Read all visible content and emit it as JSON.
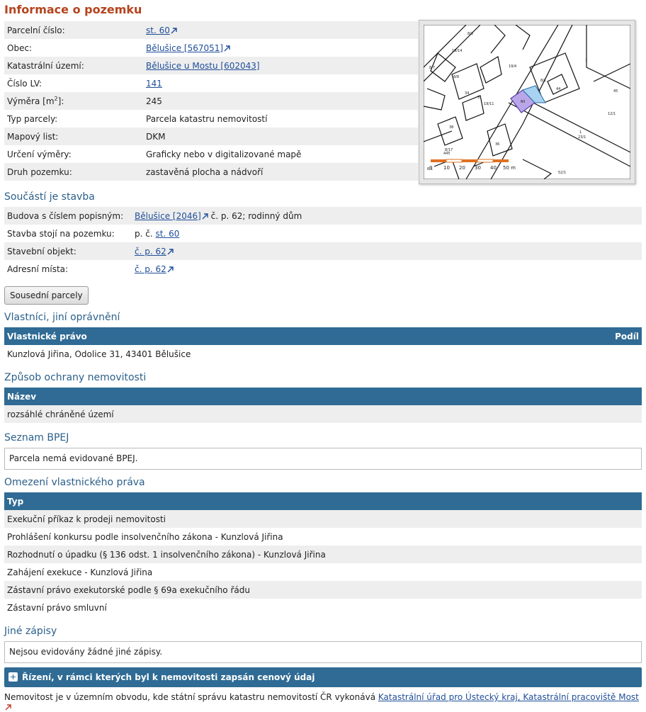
{
  "title": "Informace o pozemku",
  "parcel_info": {
    "parcelni_cislo": {
      "label": "Parcelní číslo:",
      "value": "st. 60"
    },
    "obec": {
      "label": "Obec:",
      "value": "Bělušice [567051]"
    },
    "katastralni_uzemi": {
      "label": "Katastrální území:",
      "value": "Bělušice u Mostu [602043]"
    },
    "cislo_lv": {
      "label": "Číslo LV:",
      "value": "141"
    },
    "vymera": {
      "label_main": "Výměra [m",
      "label_sup": "2",
      "label_end": "]:",
      "value": "245"
    },
    "typ_parcely": {
      "label": "Typ parcely:",
      "value": "Parcela katastru nemovitostí"
    },
    "mapovy_list": {
      "label": "Mapový list:",
      "value": "DKM"
    },
    "urceni_vymery": {
      "label": "Určení výměry:",
      "value": "Graficky nebo v digitalizované mapě"
    },
    "druh_pozemku": {
      "label": "Druh pozemku:",
      "value": "zastavěná plocha a nádvoří"
    }
  },
  "map": {
    "labels": [
      "8/3",
      "19/14",
      "19/4",
      "8/7",
      "8/8",
      "8/1",
      "34",
      "3",
      "44",
      "45",
      "1",
      "19/11",
      "12/1",
      "38",
      "60",
      "36",
      "1",
      "23/1",
      "8/17",
      "6/1",
      "445",
      "52/1"
    ],
    "scale_labels": [
      "0",
      "10",
      "20",
      "30",
      "40",
      "50 m"
    ],
    "highlight_color": "#b9a6e8",
    "neighbor_color": "#a8d2f0"
  },
  "soucast": {
    "heading": "Součástí je stavba",
    "budova": {
      "label": "Budova s číslem popisným:",
      "link": "Bělušice [2046]",
      "suffix": " č. p. 62; rodinný dům"
    },
    "stavba_stoji": {
      "label": "Stavba stojí na pozemku:",
      "prefix": "p. č. ",
      "link": "st. 60"
    },
    "stavebni_objekt": {
      "label": "Stavební objekt:",
      "link": "č. p. 62"
    },
    "adresni_mista": {
      "label": "Adresní místa:",
      "link": "č. p. 62"
    }
  },
  "sousedni_button": "Sousední parcely",
  "vlastnici": {
    "heading": "Vlastníci, jiní oprávnění",
    "col1": "Vlastnické právo",
    "col2": "Podíl",
    "rows": [
      {
        "name": "Kunzlová Jiřina, Odolice 31, 43401 Bělušice",
        "share": ""
      }
    ]
  },
  "ochrana": {
    "heading": "Způsob ochrany nemovitosti",
    "col": "Název",
    "rows": [
      "rozsáhlé chráněné území"
    ]
  },
  "bpej": {
    "heading": "Seznam BPEJ",
    "note": "Parcela nemá evidované BPEJ."
  },
  "omezeni": {
    "heading": "Omezení vlastnického práva",
    "col": "Typ",
    "rows": [
      "Exekuční příkaz k prodeji nemovitosti",
      "Prohlášení konkursu podle insolvenčního zákona - Kunzlová Jiřina",
      "Rozhodnutí o úpadku (§ 136 odst. 1 insolvenčního zákona) - Kunzlová Jiřina",
      "Zahájení exekuce - Kunzlová Jiřina",
      "Zástavní právo exekutorské podle § 69a exekučního řádu",
      "Zástavní právo smluvní"
    ]
  },
  "jine": {
    "heading": "Jiné zápisy",
    "note": "Nejsou evidovány žádné jiné zápisy."
  },
  "rizeni": {
    "label": "Řízení, v rámci kterých byl k nemovitosti zapsán cenový údaj"
  },
  "footer": {
    "text": "Nemovitost je v územním obvodu, kde státní správu katastru nemovitostí ČR vykonává ",
    "link": "Katastrální úřad pro Ústecký kraj, Katastrální pracoviště Most"
  },
  "colors": {
    "title": "#b5431d",
    "heading": "#2b5f8a",
    "header_bg": "#2f6b94",
    "link": "#1f4e9a"
  }
}
